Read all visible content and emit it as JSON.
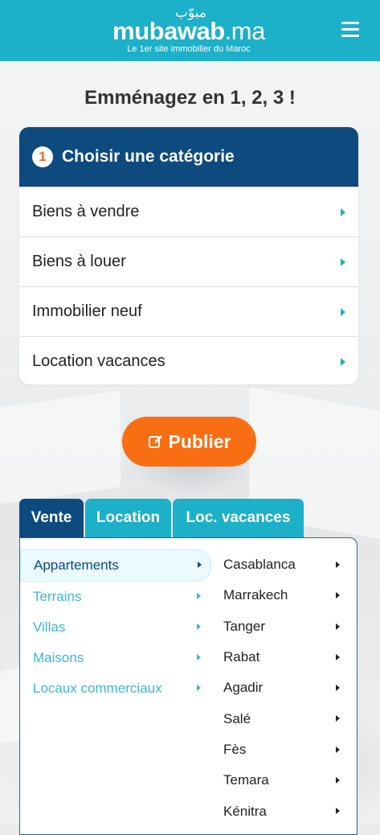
{
  "header": {
    "logo_arabic": "مبوّب",
    "logo_main": "mubawab",
    "logo_tld": ".ma",
    "tagline": "Le 1er site immobilier du Maroc",
    "menu_icon": "hamburger-menu-icon"
  },
  "headline": "Emménagez en 1, 2, 3 !",
  "category": {
    "step_number": "1",
    "title": "Choisir une catégorie",
    "items": [
      {
        "label": "Biens à vendre"
      },
      {
        "label": "Biens à louer"
      },
      {
        "label": "Immobilier neuf"
      },
      {
        "label": "Location vacances"
      }
    ]
  },
  "publish": {
    "label": "Publier",
    "icon": "edit-icon"
  },
  "tabs": [
    {
      "label": "Vente",
      "active": true
    },
    {
      "label": "Location",
      "active": false
    },
    {
      "label": "Loc. vacances",
      "active": false
    }
  ],
  "property_types": [
    {
      "label": "Appartements",
      "active": true
    },
    {
      "label": "Terrains",
      "active": false
    },
    {
      "label": "Villas",
      "active": false
    },
    {
      "label": "Maisons",
      "active": false
    },
    {
      "label": "Locaux commerciaux",
      "active": false
    }
  ],
  "cities": [
    {
      "label": "Casablanca"
    },
    {
      "label": "Marrakech"
    },
    {
      "label": "Tanger"
    },
    {
      "label": "Rabat"
    },
    {
      "label": "Agadir"
    },
    {
      "label": "Salé"
    },
    {
      "label": "Fès"
    },
    {
      "label": "Temara"
    },
    {
      "label": "Kénitra"
    }
  ],
  "colors": {
    "brand_teal": "#1cb0c9",
    "brand_navy": "#0d4a7e",
    "publish_orange": "#f96e12"
  }
}
